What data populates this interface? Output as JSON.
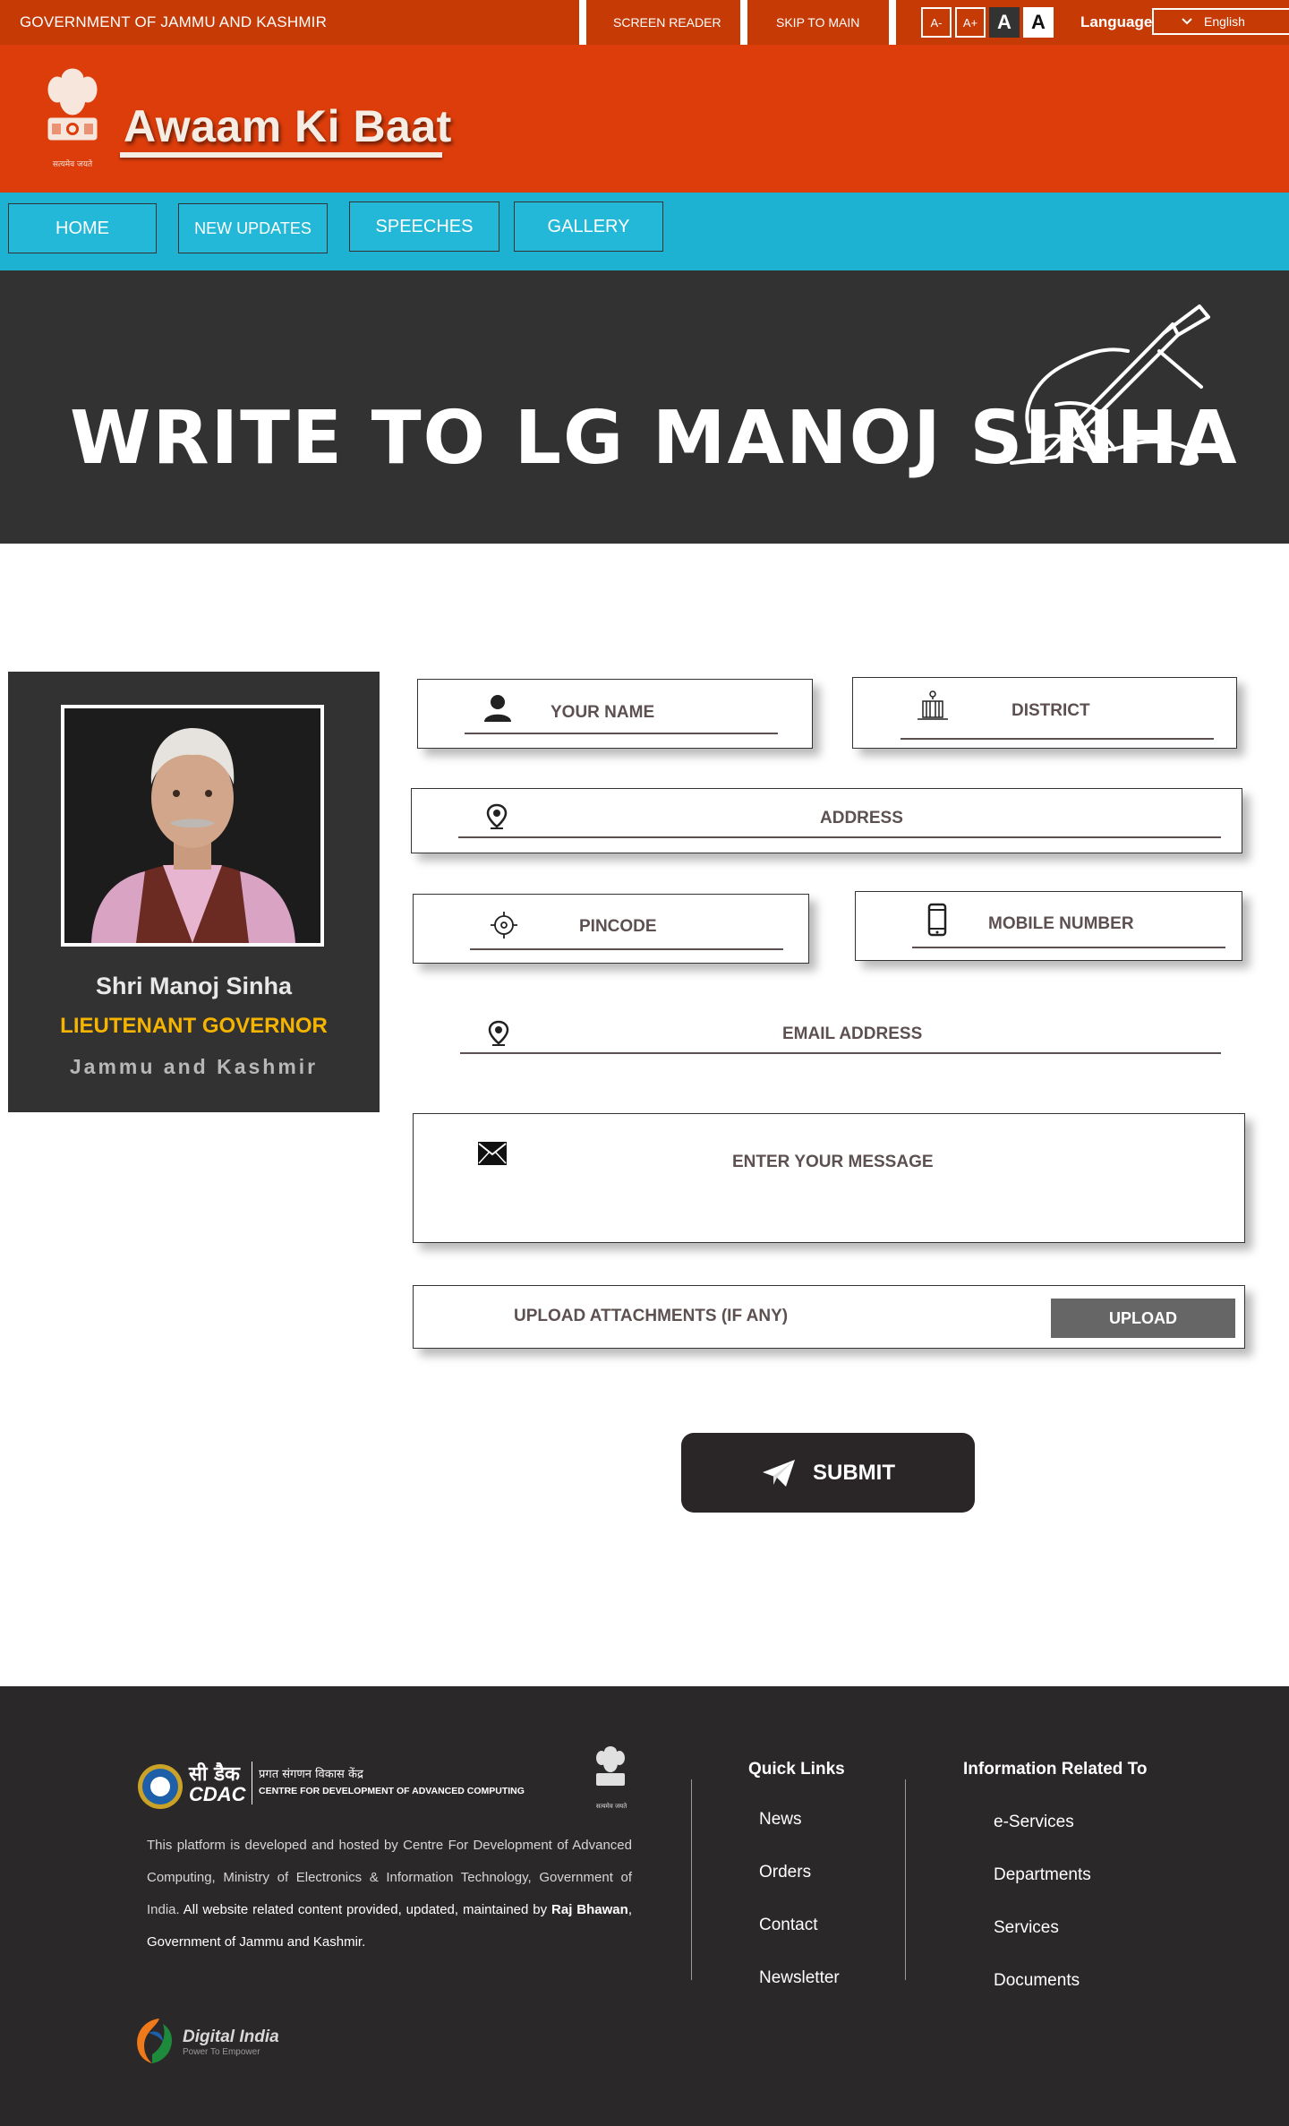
{
  "topbar": {
    "gov_title": "GOVERNMENT OF JAMMU AND KASHMIR",
    "screen_reader": "SCREEN READER",
    "skip_to_main": "SKIP TO MAIN",
    "font_decrease": "A-",
    "font_increase": "A+",
    "font_normal": "A",
    "font_large": "A",
    "language_label": "Language",
    "language_value": "English"
  },
  "header": {
    "site_title": "Awaam Ki Baat",
    "emblem_motto": "सत्यमेव जयते"
  },
  "nav": {
    "items": [
      {
        "label": "HOME"
      },
      {
        "label": "NEW UPDATES"
      },
      {
        "label": "SPEECHES"
      },
      {
        "label": "GALLERY"
      }
    ]
  },
  "banner": {
    "title": "WRITE TO LG MANOJ SINHA"
  },
  "profile": {
    "name": "Shri Manoj Sinha",
    "role": "LIEUTENANT GOVERNOR",
    "place": "Jammu and Kashmir"
  },
  "form": {
    "name_placeholder": "YOUR NAME",
    "district_placeholder": "DISTRICT",
    "address_placeholder": "ADDRESS",
    "pincode_placeholder": "PINCODE",
    "mobile_placeholder": "MOBILE NUMBER",
    "email_placeholder": "EMAIL ADDRESS",
    "message_placeholder": "ENTER YOUR MESSAGE",
    "upload_label": "UPLOAD  ATTACHMENTS (IF ANY)",
    "upload_button": "UPLOAD",
    "submit_button": "SUBMIT"
  },
  "footer": {
    "cdac_hindi_short": "सी डैक",
    "cdac_short": "CDAC",
    "cdac_hindi_full": "प्रगत संगणन विकास केंद्र",
    "cdac_full": "CENTRE FOR DEVELOPMENT OF ADVANCED COMPUTING",
    "emblem_motto": "सत्यमेव जयते",
    "about_part1": "This platform is developed and hosted by Centre For Development of Advanced Computing, Ministry of Electronics & Information Technology, Government of India.",
    "about_part2": " All website related content provided, updated, maintained  by ",
    "about_bold": "Raj Bhawan",
    "about_part3": ", Government of Jammu and Kashmir.",
    "quick_links_title": "Quick Links",
    "quick_links": [
      "News",
      "Orders",
      "Contact",
      "Newsletter"
    ],
    "info_title": "Information Related To",
    "info_links": [
      "e-Services",
      "Departments",
      "Services",
      "Documents"
    ],
    "digital_india": "Digital India",
    "digital_india_tagline": "Power To Empower"
  },
  "colors": {
    "topbar": "#c63a06",
    "header": "#dd3d0b",
    "nav": "#1eb2d2",
    "banner": "#333232",
    "accent_yellow": "#f5b400",
    "footer": "#2b2829"
  }
}
